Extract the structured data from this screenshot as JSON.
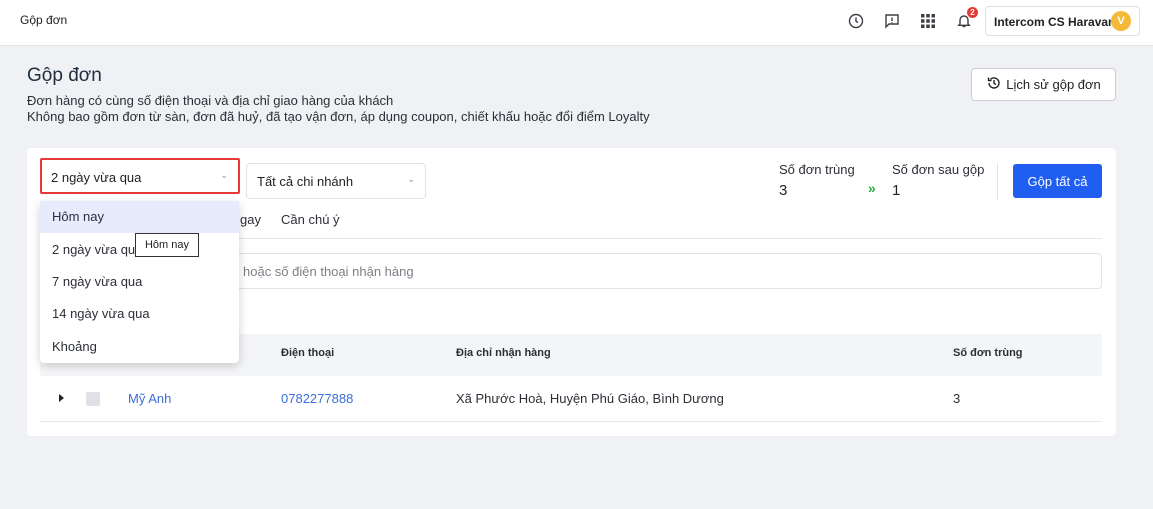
{
  "topbar": {
    "breadcrumb": "Gộp đơn",
    "icons": [
      "history-circle-icon",
      "feedback-icon",
      "apps-grid-icon",
      "bell-icon"
    ],
    "notification_count": "2",
    "account_name": "Intercom CS Haravan",
    "avatar_letter": "V"
  },
  "header": {
    "title": "Gộp đơn",
    "desc_line1": "Đơn hàng có cùng số điện thoại và địa chỉ giao hàng của khách",
    "desc_line2": "Không bao gồm đơn từ sàn, đơn đã huỷ, đã tạo vận đơn, áp dụng coupon, chiết khấu hoặc đổi điểm Loyalty",
    "history_button": "Lịch sử gộp đơn"
  },
  "filters": {
    "date_selected": "2 ngày vừa qua",
    "branch_selected": "Tất cả chi nhánh"
  },
  "stats": {
    "duplicate_label": "Số đơn trùng",
    "duplicate_value": "3",
    "after_merge_label": "Số đơn sau gộp",
    "after_merge_value": "1",
    "merge_all_button": "Gộp tất cả"
  },
  "tabs": [
    "gay",
    "Cần chú ý"
  ],
  "search": {
    "placeholder": "hoặc số điện thoại nhận hàng"
  },
  "table": {
    "columns": [
      "Điện thoại",
      "Địa chỉ nhận hàng",
      "Số đơn trùng"
    ],
    "rows": [
      {
        "name": "Mỹ Anh",
        "phone": "0782277888",
        "address": "Xã Phước Hoà, Huyện Phú Giáo, Bình Dương",
        "count": "3"
      }
    ]
  },
  "date_menu": {
    "options": [
      "Hôm nay",
      "2 ngày vừa qua",
      "7 ngày vừa qua",
      "14 ngày vừa qua",
      "Khoảng"
    ],
    "highlighted": "Hôm nay",
    "tooltip": "Hôm nay"
  },
  "colors": {
    "primary": "#1f5ef0",
    "highlight_border": "#e53935",
    "link": "#3b6fd9",
    "arrow": "#2eaa3f"
  }
}
